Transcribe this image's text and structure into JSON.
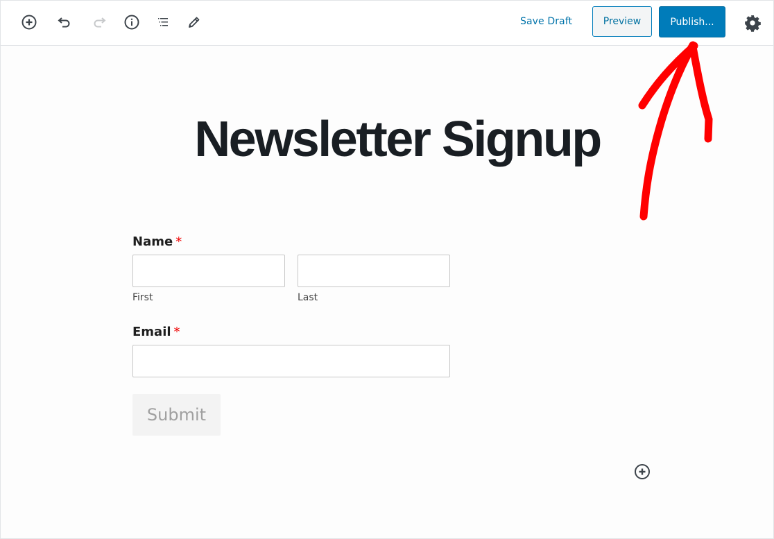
{
  "toolbar": {
    "left_icons": [
      {
        "name": "add-block-icon",
        "enabled": true
      },
      {
        "name": "undo-icon",
        "enabled": true
      },
      {
        "name": "redo-icon",
        "enabled": false
      },
      {
        "name": "info-icon",
        "enabled": true
      },
      {
        "name": "block-navigation-icon",
        "enabled": true
      },
      {
        "name": "edit-mode-icon",
        "enabled": true
      }
    ],
    "save_draft_label": "Save Draft",
    "preview_label": "Preview",
    "publish_label": "Publish...",
    "settings_icon": "gear-icon"
  },
  "colors": {
    "accent": "#007cba",
    "link": "#0073aa",
    "required": "#ee0000",
    "annotation": "#ff0000",
    "title": "#191e23"
  },
  "page": {
    "title": "Newsletter Signup"
  },
  "form": {
    "name_field": {
      "label": "Name",
      "required_marker": "*",
      "first": {
        "value": "",
        "sublabel": "First"
      },
      "last": {
        "value": "",
        "sublabel": "Last"
      }
    },
    "email_field": {
      "label": "Email",
      "required_marker": "*",
      "value": ""
    },
    "submit_label": "Submit"
  },
  "annotation": {
    "type": "hand-drawn-arrow",
    "points_to": "publish-button"
  }
}
